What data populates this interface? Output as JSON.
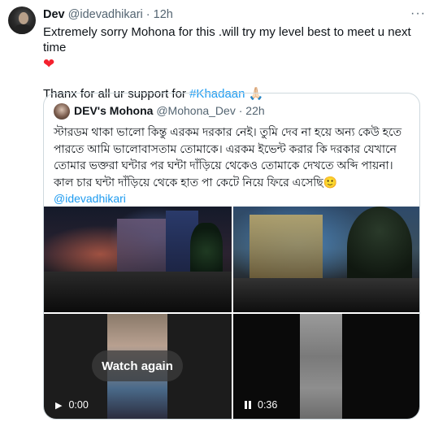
{
  "tweet": {
    "author_name": "Dev",
    "author_handle": "@idevadhikari",
    "separator": "·",
    "time": "12h",
    "more_icon": "more-dots-icon",
    "line1": "Extremely sorry Mohona for this .will try my level best to meet u next time",
    "heart_emoji": "❤",
    "line2_prefix": "Thanx for all ur support for ",
    "hashtag": "#Khadaan",
    "pray_emoji": "🙏🏻"
  },
  "quoted": {
    "author_name": "DEV's Mohona",
    "author_handle": "@Mohona_Dev",
    "separator": "·",
    "time": "22h",
    "text": "স্টারডম থাকা ভালো কিন্তু এরকম দরকার নেই। তুমি দেব না হয়ে অন্য কেউ হতে পারতে আমি ভালোবাসতাম তোমাকে। এরকম ইভেন্ট করার কি দরকার যেখানে তোমার ভক্তরা ঘন্টার পর ঘন্টা দাঁড়িয়ে থেকেও তোমাকে দেখতে অব্দি পায়না। কাল চার ঘন্টা দাঁড়িয়ে থেকে হাত পা কেটে নিয়ে ফিরে এসেছি🙂",
    "mention": "@idevadhikari"
  },
  "media": {
    "video1": {
      "overlay_label": "Watch again",
      "time": "0:00",
      "control_icon": "play-icon"
    },
    "video2": {
      "time": "0:36",
      "control_icon": "pause-icon"
    }
  }
}
